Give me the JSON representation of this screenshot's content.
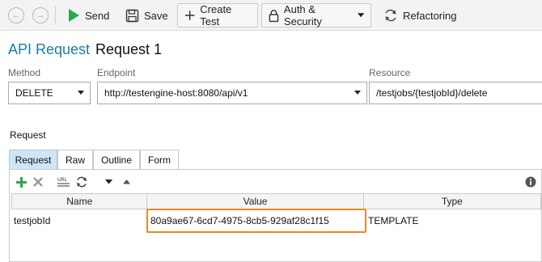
{
  "toolbar": {
    "back_glyph": "←",
    "forward_glyph": "→",
    "send_label": "Send",
    "save_label": "Save",
    "create_test_label": "Create Test",
    "auth_label": "Auth & Security",
    "refactoring_label": "Refactoring"
  },
  "header": {
    "title_prefix": "API Request",
    "request_name": "Request 1"
  },
  "fields": {
    "method_label": "Method",
    "method_value": "DELETE",
    "endpoint_label": "Endpoint",
    "endpoint_value": "http://testengine-host:8080/api/v1",
    "resource_label": "Resource",
    "resource_value": "/testjobs/{testjobId}/delete"
  },
  "request_section": {
    "label": "Request",
    "tabs": [
      "Request",
      "Raw",
      "Outline",
      "Form"
    ],
    "active_tab": "Request",
    "url_icon_text": "URL",
    "columns": [
      "Name",
      "Value",
      "Type"
    ],
    "rows": [
      {
        "name": "testjobId",
        "value": "80a9ae67-6cd7-4975-8cb5-929af28c1f15",
        "type": "TEMPLATE"
      }
    ]
  },
  "colors": {
    "accent_title": "#1a7ea0",
    "send_icon": "#2fa84f",
    "add_icon": "#2fa84f",
    "highlight_border": "#e88a1f",
    "active_tab": "#cfe6f6"
  },
  "icons": [
    "back-icon",
    "forward-icon",
    "send-icon",
    "save-icon",
    "plus-icon",
    "lock-icon",
    "refresh-icon",
    "add-icon",
    "delete-icon",
    "url-encode-icon",
    "sync-icon",
    "chevron-down-icon",
    "chevron-up-icon",
    "info-icon"
  ]
}
